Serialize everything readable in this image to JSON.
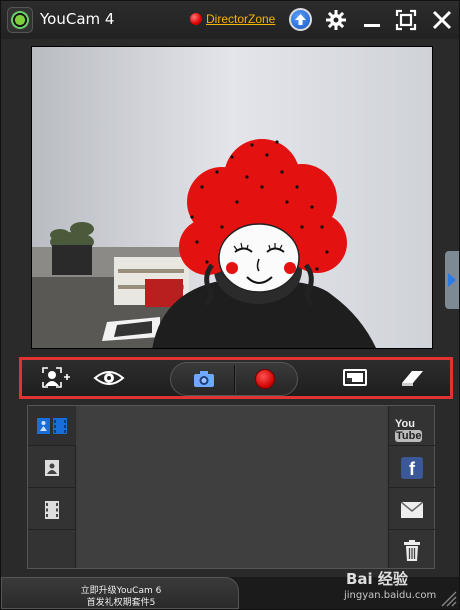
{
  "titlebar": {
    "app_title": "YouCam 4",
    "director_zone_label": "DirectorZone",
    "icons": [
      "app-logo-icon",
      "director-zone-dot-icon",
      "upload-icon",
      "gear-icon",
      "minimize-icon",
      "restore-icon",
      "close-icon"
    ]
  },
  "video": {
    "description_icons": [
      "webcam-feed"
    ]
  },
  "toolbar": {
    "tools": [
      "face-tracking-icon",
      "eye-icon",
      "camera-icon",
      "record-icon",
      "monitor-icon",
      "eraser-icon"
    ]
  },
  "gallery": {
    "tabs": [
      "all-media-icon",
      "photo-icon",
      "video-icon"
    ],
    "share": {
      "youtube_you": "You",
      "youtube_tube": "Tube",
      "facebook": "f",
      "icons": [
        "youtube-icon",
        "facebook-icon",
        "email-icon",
        "trash-icon"
      ]
    }
  },
  "footer": {
    "promo_line1": "立即升级YouCam 6",
    "promo_line2": "首发礼权期套件5"
  },
  "watermark": {
    "brand": "Bai 经验",
    "url": "jingyan.baidu.com"
  },
  "colors": {
    "accent_red": "#e03333",
    "link_gold": "#f5b400",
    "wig_red": "#e41111",
    "facebook_blue": "#3b5998"
  }
}
